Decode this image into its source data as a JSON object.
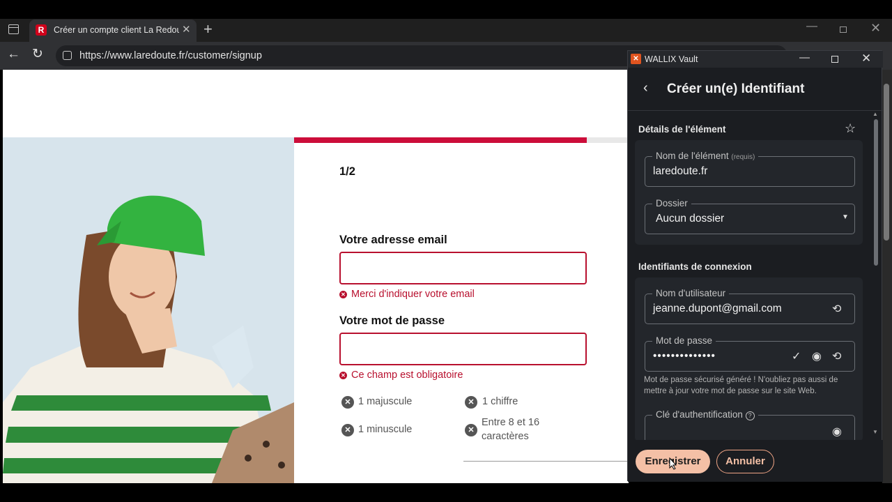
{
  "browser": {
    "tab_title": "Créer un compte client La Redoute",
    "tab_favicon_letter": "R",
    "url": "https://www.laredoute.fr/customer/signup"
  },
  "page": {
    "step": "1/2",
    "progress": 0.875,
    "email_label": "Votre adresse email",
    "email_error": "Merci d'indiquer votre email",
    "password_label": "Votre mot de passe",
    "password_error": "Ce champ est obligatoire",
    "rules": {
      "uppercase": "1 majuscule",
      "digit": "1 chiffre",
      "lowercase": "1 minuscule",
      "length_line1": "Entre 8 et 16",
      "length_line2": "caractères"
    },
    "colors": {
      "brand": "#cc0d3a",
      "error": "#b8102e"
    }
  },
  "vault": {
    "app_title": "WALLIX Vault",
    "heading": "Créer un(e) Identifiant",
    "section_details": "Détails de l'élément",
    "item_name_label": "Nom de l'élément",
    "item_name_required": "(requis)",
    "item_name_value": "laredoute.fr",
    "folder_label": "Dossier",
    "folder_value": "Aucun dossier",
    "section_credentials": "Identifiants de connexion",
    "username_label": "Nom d'utilisateur",
    "username_value": "jeanne.dupont@gmail.com",
    "password_label": "Mot de passe",
    "password_value": "••••••••••••••",
    "password_hint": "Mot de passe sécurisé généré ! N'oubliez pas aussi de mettre à jour votre mot de passe sur le site Web.",
    "auth_key_label": "Clé d'authentification",
    "save_button": "Enregistrer",
    "cancel_button": "Annuler",
    "colors": {
      "accent": "#f4c0a6",
      "panel": "#1b1d21"
    }
  }
}
